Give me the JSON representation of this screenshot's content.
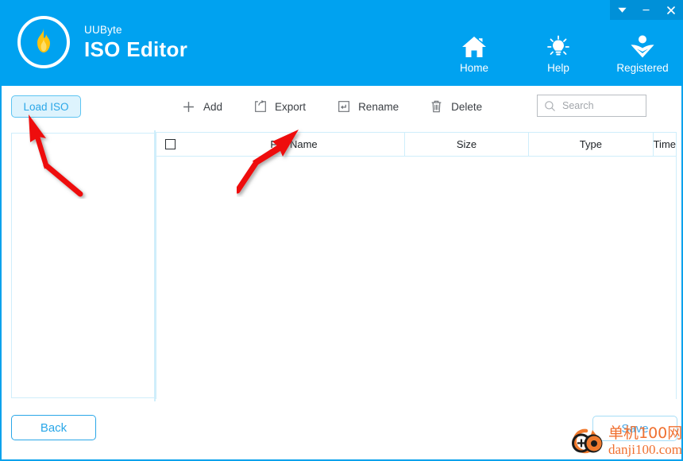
{
  "window": {
    "controls": [
      {
        "name": "minimize-to-tray",
        "glyph": "chevron-down-icon"
      },
      {
        "name": "minimize",
        "glyph": "minimize-icon"
      },
      {
        "name": "close",
        "glyph": "close-icon"
      }
    ]
  },
  "header": {
    "brand_sub": "UUByte",
    "brand_main": "ISO Editor",
    "logo_icon": "flame-icon",
    "accent_color": "#00a2f0",
    "titlebar_color": "#0090d8",
    "nav": [
      {
        "label": "Home",
        "icon": "home-icon"
      },
      {
        "label": "Help",
        "icon": "lightbulb-icon"
      },
      {
        "label": "Registered",
        "icon": "user-badge-icon"
      }
    ]
  },
  "toolbar": {
    "load_iso_label": "Load ISO",
    "actions": [
      {
        "label": "Add",
        "icon": "plus-icon"
      },
      {
        "label": "Export",
        "icon": "export-icon"
      },
      {
        "label": "Rename",
        "icon": "rename-icon"
      },
      {
        "label": "Delete",
        "icon": "trash-icon"
      }
    ],
    "search": {
      "placeholder": "Search",
      "value": "",
      "icon": "search-icon"
    }
  },
  "table": {
    "columns": [
      "File Name",
      "Size",
      "Type",
      "Time"
    ],
    "select_all_checked": false,
    "rows": []
  },
  "footer": {
    "back_label": "Back",
    "save_label": "Save"
  },
  "annotations": {
    "arrow_color": "#ee1111",
    "arrows": [
      {
        "name": "arrow-to-load-iso"
      },
      {
        "name": "arrow-to-file-name-column"
      }
    ]
  },
  "watermark": {
    "cn": "单机100网",
    "en": "danji100.com",
    "color": "#f07030"
  }
}
